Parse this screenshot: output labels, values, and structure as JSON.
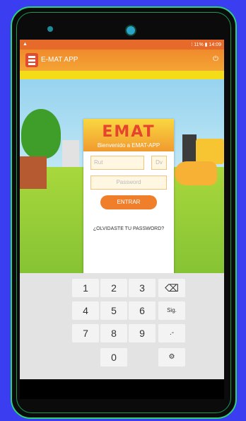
{
  "status_bar": {
    "time_battery": "⁞ 11% ▮ 14:09"
  },
  "app_bar": {
    "title": "E-MAT APP"
  },
  "login_card": {
    "brand": "EMAT",
    "welcome": "Bienvenido a EMAT-APP",
    "rut_placeholder": "Rut",
    "dv_placeholder": "Dv",
    "password_placeholder": "Password",
    "enter_label": "ENTRAR",
    "forgot_label": "¿OLVIDASTE TU PASSWORD?"
  },
  "keyboard": {
    "keys": [
      "1",
      "2",
      "3",
      "⌫",
      "4",
      "5",
      "6",
      "Sig.",
      "7",
      "8",
      "9",
      ".-",
      "0",
      "⚙"
    ]
  },
  "colors": {
    "accent": "#ef7f2a",
    "frame": "#2bd27a",
    "background": "#3b3df0"
  }
}
